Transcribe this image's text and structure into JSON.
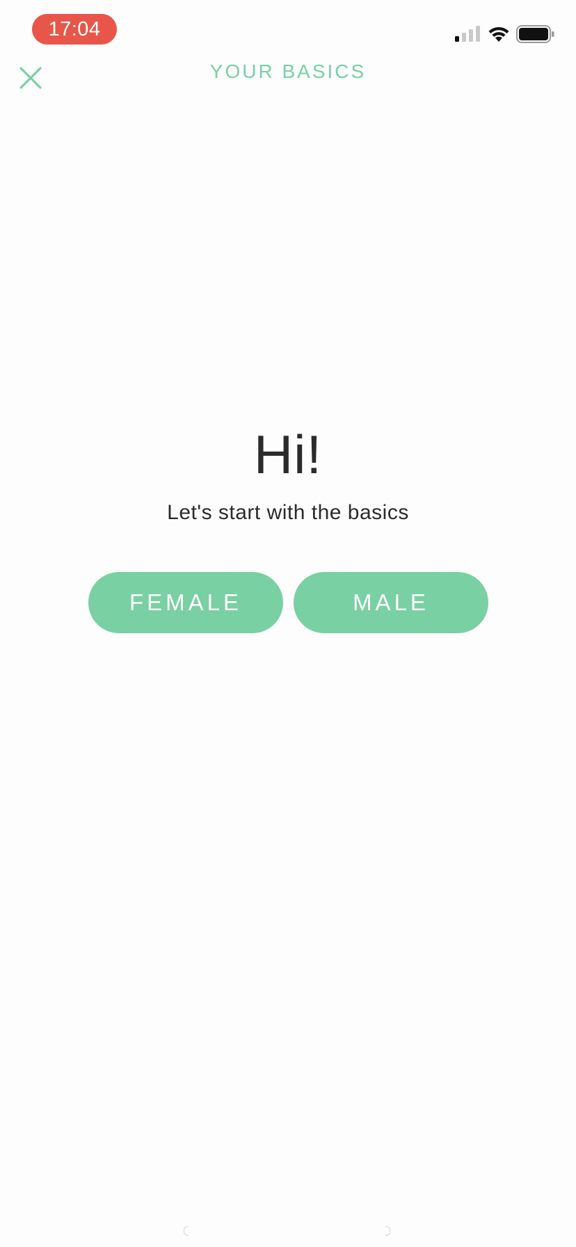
{
  "status_bar": {
    "time": "17:04",
    "time_pill_color": "#e8564a",
    "icons": [
      "signal-icon",
      "wifi-icon",
      "battery-icon"
    ]
  },
  "nav": {
    "title": "YOUR BASICS",
    "close_icon": "close-icon",
    "accent_color": "#79d0a3"
  },
  "main": {
    "greeting": "Hi!",
    "subtitle": "Let's start with the basics",
    "options": [
      {
        "label": "FEMALE"
      },
      {
        "label": "MALE"
      }
    ],
    "button_color": "#79d0a3"
  }
}
